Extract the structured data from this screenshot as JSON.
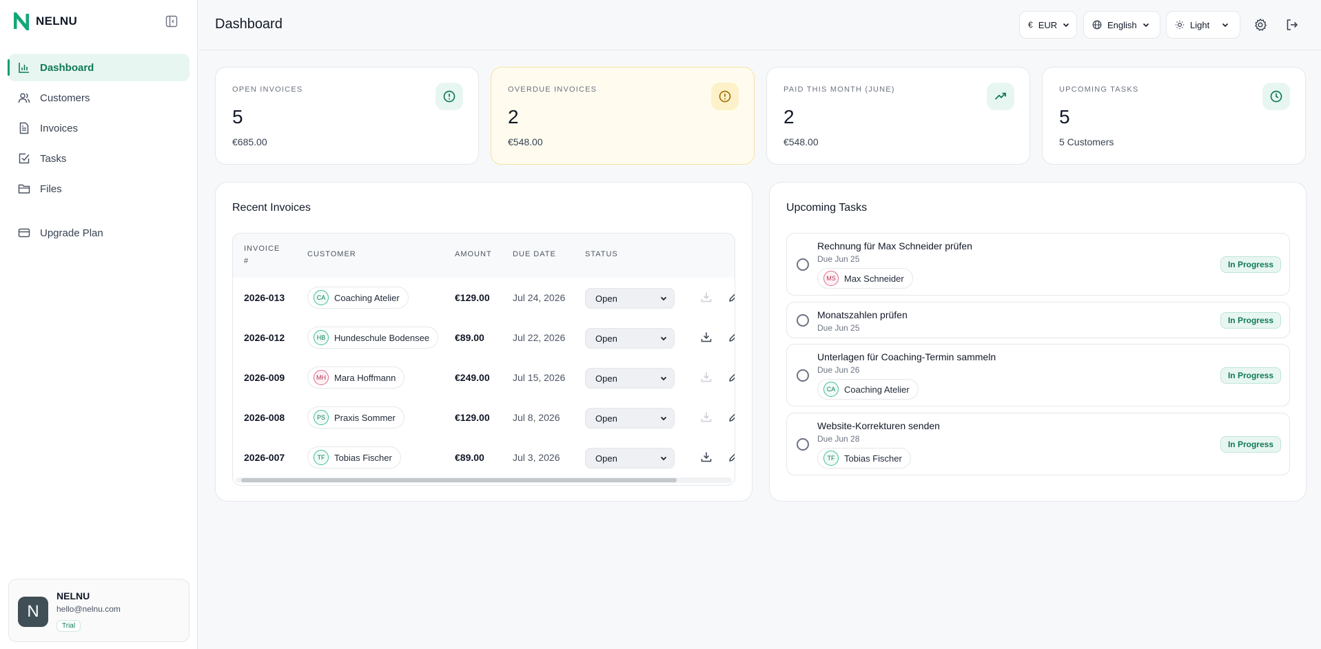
{
  "brand": {
    "name": "NELNU"
  },
  "sidebar": {
    "items": [
      {
        "label": "Dashboard",
        "icon": "bar-chart-icon",
        "active": true
      },
      {
        "label": "Customers",
        "icon": "users-icon"
      },
      {
        "label": "Invoices",
        "icon": "file-text-icon"
      },
      {
        "label": "Tasks",
        "icon": "check-square-icon"
      },
      {
        "label": "Files",
        "icon": "folder-icon"
      }
    ],
    "upgrade": {
      "label": "Upgrade Plan",
      "icon": "credit-card-icon"
    }
  },
  "user": {
    "initial": "N",
    "name": "NELNU",
    "email": "hello@nelnu.com",
    "plan": "Trial"
  },
  "header": {
    "title": "Dashboard",
    "currency": {
      "symbol": "€",
      "value": "EUR"
    },
    "language": "English",
    "theme": "Light"
  },
  "stats": [
    {
      "label": "OPEN INVOICES",
      "value": "5",
      "sub": "€685.00",
      "icon": "alert-circle-icon"
    },
    {
      "label": "OVERDUE INVOICES",
      "value": "2",
      "sub": "€548.00",
      "icon": "alert-circle-icon"
    },
    {
      "label": "PAID THIS MONTH (JUNE)",
      "value": "2",
      "sub": "€548.00",
      "icon": "trending-up-icon"
    },
    {
      "label": "UPCOMING TASKS",
      "value": "5",
      "sub": "5 Customers",
      "icon": "clock-icon"
    }
  ],
  "invoices": {
    "title": "Recent Invoices",
    "columns": {
      "invoice_line1": "INVOICE",
      "invoice_line2": "#",
      "customer": "CUSTOMER",
      "amount": "AMOUNT",
      "due": "DUE DATE",
      "status": "STATUS"
    },
    "rows": [
      {
        "number": "2026-013",
        "initials": "CA",
        "customer": "Coaching Atelier",
        "amount": "€129.00",
        "due": "Jul 24, 2026",
        "status": "Open"
      },
      {
        "number": "2026-012",
        "initials": "HB",
        "customer": "Hundeschule Bodensee",
        "amount": "€89.00",
        "due": "Jul 22, 2026",
        "status": "Open"
      },
      {
        "number": "2026-009",
        "initials": "MH",
        "customer": "Mara Hoffmann",
        "amount": "€249.00",
        "due": "Jul 15, 2026",
        "status": "Open"
      },
      {
        "number": "2026-008",
        "initials": "PS",
        "customer": "Praxis Sommer",
        "amount": "€129.00",
        "due": "Jul 8, 2026",
        "status": "Open"
      },
      {
        "number": "2026-007",
        "initials": "TF",
        "customer": "Tobias Fischer",
        "amount": "€89.00",
        "due": "Jul 3, 2026",
        "status": "Open"
      }
    ]
  },
  "tasks": {
    "title": "Upcoming Tasks",
    "items": [
      {
        "title": "Rechnung für Max Schneider prüfen",
        "due": "Due Jun 25",
        "initials": "MS",
        "customer": "Max Schneider",
        "status": "In Progress"
      },
      {
        "title": "Monatszahlen prüfen",
        "due": "Due Jun 25",
        "status": "In Progress"
      },
      {
        "title": "Unterlagen für Coaching-Termin sammeln",
        "due": "Due Jun 26",
        "initials": "CA",
        "customer": "Coaching Atelier",
        "status": "In Progress"
      },
      {
        "title": "Website-Korrekturen senden",
        "due": "Due Jun 28",
        "initials": "TF",
        "customer": "Tobias Fischer",
        "status": "In Progress"
      }
    ]
  },
  "colors": {
    "accent": "#0f9d70",
    "accent_bg": "#e8f6f1",
    "warning": "#d4a017",
    "warning_bg": "#fffcef"
  }
}
